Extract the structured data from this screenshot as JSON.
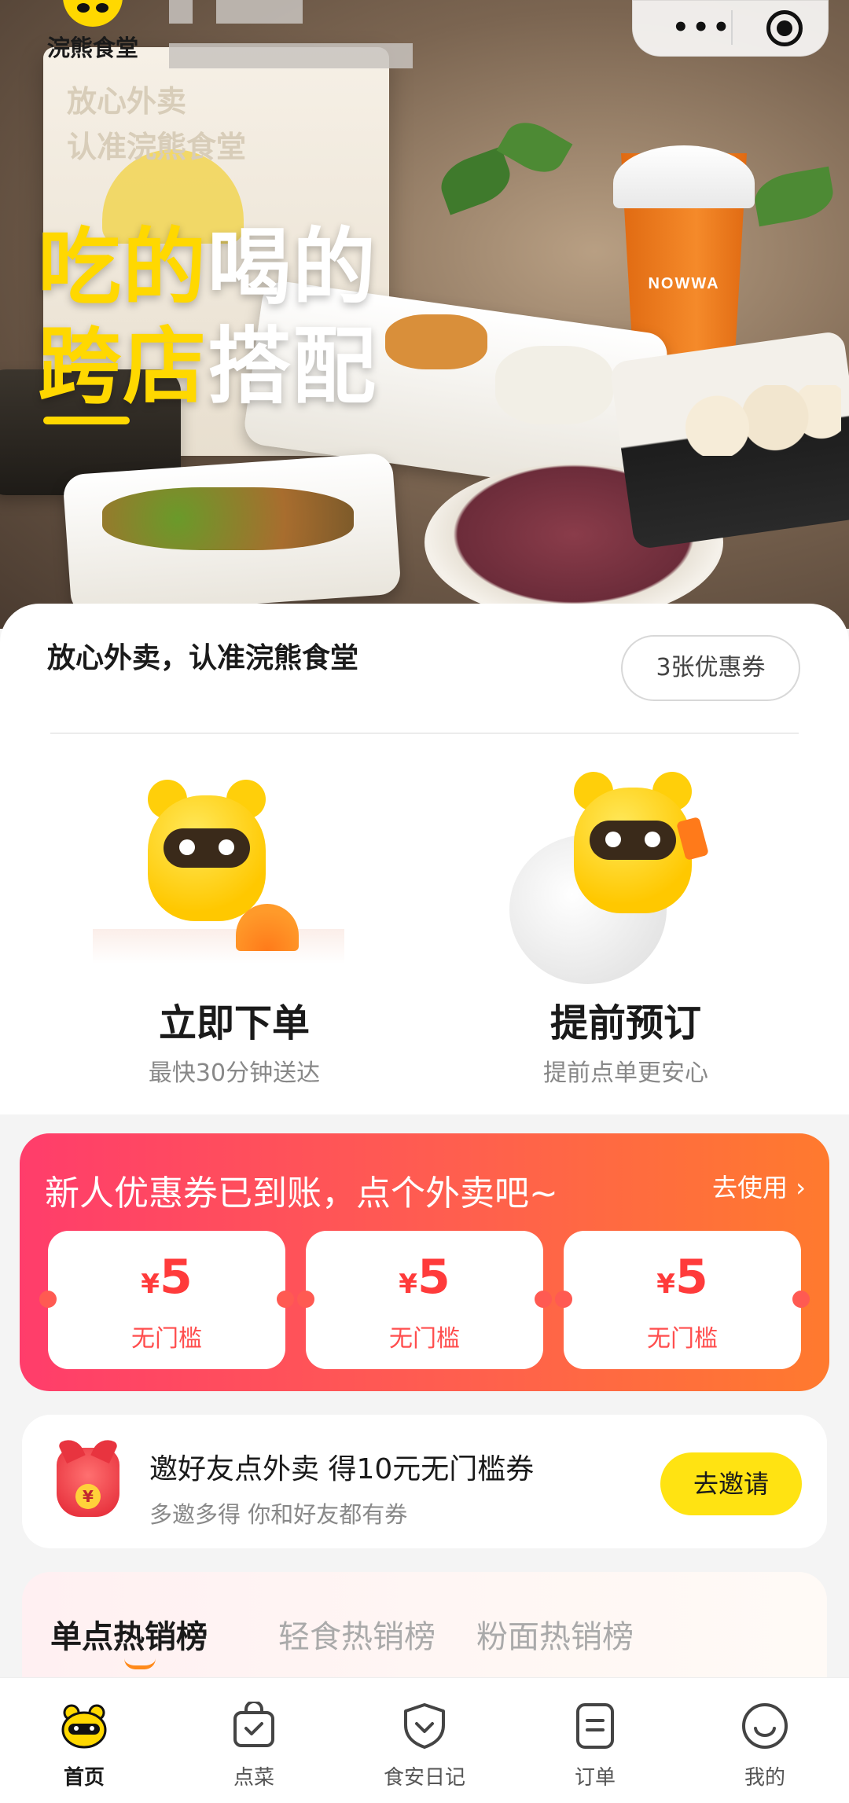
{
  "header": {
    "logo_text": "浣熊食堂"
  },
  "hero": {
    "bag_line1": "放心外卖",
    "bag_line2": "认准浣熊食堂",
    "headline_line1_yellow": "吃的",
    "headline_line1_white": "喝的",
    "headline_line2_yellow": "跨店",
    "headline_line2_white": "搭配",
    "cup_brand": "NOWWA"
  },
  "main": {
    "slogan": "放心外卖，认准浣熊食堂",
    "coupon_count_label": "3张优惠券",
    "actions": [
      {
        "title": "立即下单",
        "subtitle": "最快30分钟送达"
      },
      {
        "title": "提前预订",
        "subtitle": "提前点单更安心"
      }
    ]
  },
  "promo": {
    "title": "新人优惠券已到账，点个外卖吧~",
    "link": "去使用 ›",
    "coupons": [
      {
        "currency": "¥",
        "value": "5",
        "note": "无门槛"
      },
      {
        "currency": "¥",
        "value": "5",
        "note": "无门槛"
      },
      {
        "currency": "¥",
        "value": "5",
        "note": "无门槛"
      }
    ]
  },
  "invite": {
    "title": "邀好友点外卖 得10元无门槛券",
    "subtitle": "多邀多得 你和好友都有券",
    "button": "去邀请",
    "icon_glyph": "¥"
  },
  "ranking": {
    "tabs": [
      "单点热销榜",
      "轻食热销榜",
      "粉面热销榜"
    ],
    "active_index": 0
  },
  "tabbar": {
    "items": [
      {
        "label": "首页",
        "icon": "raccoon-home-icon",
        "active": true
      },
      {
        "label": "点菜",
        "icon": "bag-check-icon",
        "active": false
      },
      {
        "label": "食安日记",
        "icon": "shield-check-icon",
        "active": false
      },
      {
        "label": "订单",
        "icon": "order-list-icon",
        "active": false
      },
      {
        "label": "我的",
        "icon": "smile-icon",
        "active": false
      }
    ]
  },
  "colors": {
    "brand_yellow": "#ffd800",
    "promo_start": "#ff3d6b",
    "promo_end": "#ff7a2e",
    "coupon_red": "#ff3b3b",
    "invite_button": "#ffe312"
  }
}
